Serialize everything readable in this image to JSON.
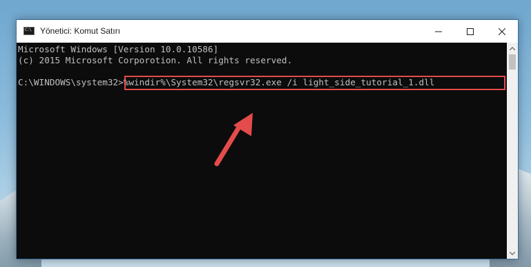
{
  "window": {
    "title": "Yönetici: Komut Satırı",
    "icon_text": "C:\\"
  },
  "title_buttons": {
    "minimize_icon": "minimize-icon",
    "maximize_icon": "maximize-icon",
    "close_icon": "close-icon"
  },
  "terminal": {
    "lines": [
      "Microsoft Windows [Version 10.0.10586]",
      "(c) 2015 Microsoft Corporotion. All rights reserved.",
      "",
      "C:\\WINDOWS\\system32>%windir%\\System32\\regsvr32.exe /i light_side_tutorial_1.dll"
    ]
  },
  "annotation": {
    "highlight_color": "#e44b4b",
    "arrow_color": "#e44b4b"
  },
  "colors": {
    "terminal_bg": "#0c0c0c",
    "terminal_text": "#c0c0c0",
    "window_border": "#3b6fa0"
  }
}
